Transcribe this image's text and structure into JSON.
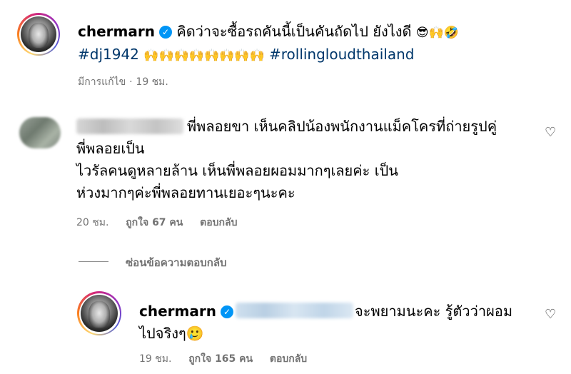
{
  "post": {
    "username": "chermarn",
    "verified_mark": "✓",
    "caption_text": "คิดว่าจะซื้อรถคันนี้เป็นคันถัดไป ยังไงดี",
    "caption_emojis": "😎🙌🤣",
    "hashtag_1": "#dj1942",
    "raised_hands": "🙌🙌🙌🙌🙌🙌🙌🙌",
    "hashtag_2": "#rollingloudthailand",
    "edited_label": "มีการแก้ไข",
    "separator": "·",
    "time": "19 ชม."
  },
  "comment": {
    "text_line1": "พี่พลอยขา เห็นคลิปน้องพนักงานแม็คโครที่ถ่ายรูปคู่",
    "text_line2": "พี่พลอยเป็น",
    "text_line3": "ไวรัลคนดูหลายล้าน เห็นพี่พลอยผอมมากๆเลยค่ะ เป็น",
    "text_line4": "ห่วงมากๆค่ะพี่พลอยทานเยอะๆนะคะ",
    "time": "20 ชม.",
    "likes": "ถูกใจ 67 คน",
    "reply_label": "ตอบกลับ",
    "like_icon": "♡"
  },
  "replies_toggle": {
    "label": "ซ่อนข้อความตอบกลับ"
  },
  "reply": {
    "username": "chermarn",
    "verified_mark": "✓",
    "text_line1": "จะพยามนะคะ รู้ตัวว่าผอม",
    "text_line2": "ไปจริงๆ🥲",
    "time": "19 ชม.",
    "likes": "ถูกใจ 165 คน",
    "reply_label": "ตอบกลับ",
    "like_icon": "♡"
  },
  "colors": {
    "hashtag": "#00376b",
    "verified": "#0095f6",
    "meta_gray": "#737373"
  }
}
